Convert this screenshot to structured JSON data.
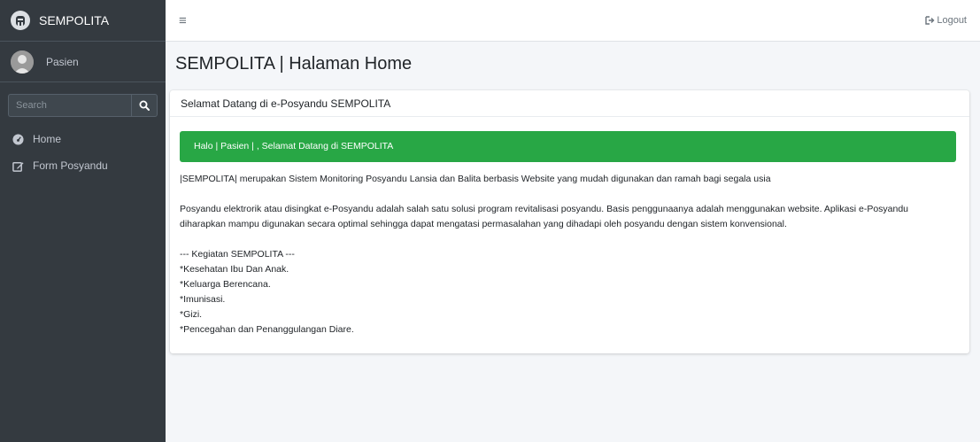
{
  "brand": {
    "name": "SEMPOLITA"
  },
  "user": {
    "name": "Pasien"
  },
  "search": {
    "placeholder": "Search"
  },
  "sidebar": {
    "items": [
      {
        "label": "Home",
        "icon": "tachometer-icon"
      },
      {
        "label": "Form Posyandu",
        "icon": "edit-icon"
      }
    ]
  },
  "topbar": {
    "menu_icon": "≡",
    "logout_label": "Logout"
  },
  "page": {
    "title": "SEMPOLITA | Halaman Home"
  },
  "card": {
    "header": "Selamat Datang di e-Posyandu SEMPOLITA",
    "alert": "Halo | Pasien | , Selamat Datang di SEMPOLITA",
    "paragraph1": "|SEMPOLITA| merupakan Sistem Monitoring Posyandu Lansia dan Balita berbasis Website yang mudah digunakan dan ramah bagi segala usia",
    "paragraph2_line1": "Posyandu elektrorik atau disingkat e-Posyandu adalah salah satu solusi program revitalisasi posyandu. Basis penggunaanya adalah menggunakan website. Aplikasi e-Posyandu",
    "paragraph2_line2": "diharapkan mampu digunakan secara optimal sehingga dapat mengatasi permasalahan yang dihadapi oleh posyandu dengan sistem konvensional.",
    "activities_title": "--- Kegiatan SEMPOLITA ---",
    "activities": [
      "*Kesehatan Ibu Dan Anak.",
      "*Keluarga Berencana.",
      "*Imunisasi.",
      "*Gizi.",
      "*Pencegahan dan Penanggulangan Diare."
    ]
  },
  "colors": {
    "sidebar_bg": "#343a40",
    "alert_green": "#28a745",
    "content_bg": "#f4f6f9"
  }
}
